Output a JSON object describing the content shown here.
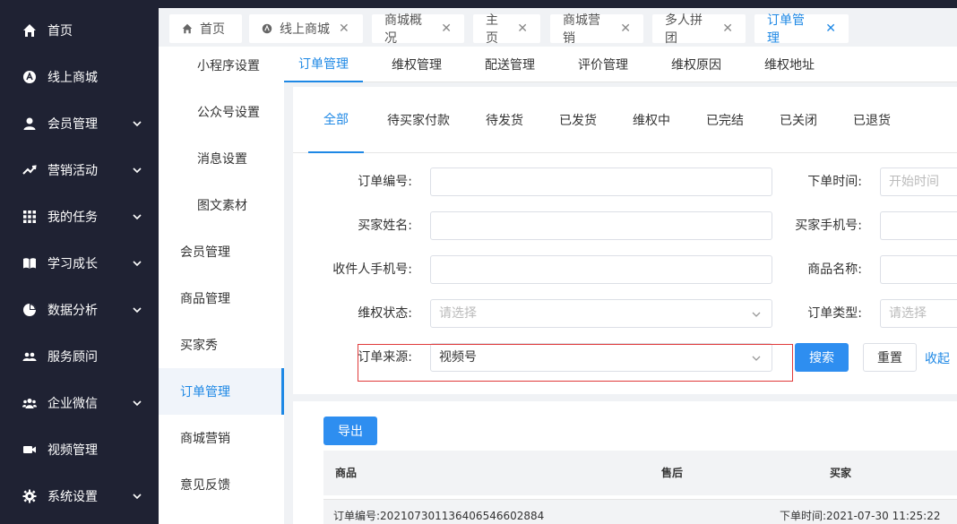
{
  "sidebar": {
    "items": [
      {
        "label": "首页",
        "icon": "home-icon",
        "has_chevron": false
      },
      {
        "label": "线上商城",
        "icon": "shop-icon",
        "has_chevron": false
      },
      {
        "label": "会员管理",
        "icon": "user-icon",
        "has_chevron": true
      },
      {
        "label": "营销活动",
        "icon": "trend-icon",
        "has_chevron": true
      },
      {
        "label": "我的任务",
        "icon": "grid-icon",
        "has_chevron": true
      },
      {
        "label": "学习成长",
        "icon": "book-icon",
        "has_chevron": true
      },
      {
        "label": "数据分析",
        "icon": "pie-icon",
        "has_chevron": true
      },
      {
        "label": "服务顾问",
        "icon": "people-icon",
        "has_chevron": false
      },
      {
        "label": "企业微信",
        "icon": "group-icon",
        "has_chevron": true
      },
      {
        "label": "视频管理",
        "icon": "video-icon",
        "has_chevron": false
      },
      {
        "label": "系统设置",
        "icon": "gear-icon",
        "has_chevron": true
      }
    ]
  },
  "top_tabs": [
    {
      "label": "首页",
      "closable": false
    },
    {
      "label": "线上商城",
      "closable": true
    },
    {
      "label": "商城概况",
      "closable": true
    },
    {
      "label": "主页",
      "closable": true
    },
    {
      "label": "商城营销",
      "closable": true
    },
    {
      "label": "多人拼团",
      "closable": true
    },
    {
      "label": "订单管理",
      "closable": true,
      "active": true
    }
  ],
  "close_glyph": "✕",
  "submenu": {
    "items": [
      {
        "label": "小程序设置"
      },
      {
        "label": "公众号设置"
      },
      {
        "label": "消息设置"
      },
      {
        "label": "图文素材"
      },
      {
        "label": "会员管理"
      },
      {
        "label": "商品管理"
      },
      {
        "label": "买家秀"
      },
      {
        "label": "订单管理"
      },
      {
        "label": "商城营销"
      },
      {
        "label": "意见反馈"
      }
    ]
  },
  "sub_tabs": [
    "订单管理",
    "维权管理",
    "配送管理",
    "评价管理",
    "维权原因",
    "维权地址"
  ],
  "status_tabs": [
    "全部",
    "待买家付款",
    "待发货",
    "已发货",
    "维权中",
    "已完结",
    "已关闭",
    "已退货"
  ],
  "form": {
    "order_no_label": "订单编号:",
    "order_time_label": "下单时间:",
    "order_time_placeholder": "开始时间",
    "buyer_name_label": "买家姓名:",
    "buyer_phone_label": "买家手机号:",
    "receiver_phone_label": "收件人手机号:",
    "product_name_label": "商品名称:",
    "rights_status_label": "维权状态:",
    "rights_status_placeholder": "请选择",
    "order_type_label": "订单类型:",
    "order_type_placeholder": "请选择",
    "order_source_label": "订单来源:",
    "order_source_value": "视频号",
    "search_label": "搜索",
    "reset_label": "重置",
    "collapse_label": "收起"
  },
  "export_label": "导出",
  "table": {
    "columns": [
      "商品",
      "售后",
      "买家"
    ],
    "order_no": "订单编号:20210730113640654660288​4",
    "order_time": "下单时间:2021-07-30 11:25:22"
  },
  "colors": {
    "primary": "#1e88e5",
    "sidebar_bg": "#1f2233",
    "highlight": "#e03a3a"
  }
}
